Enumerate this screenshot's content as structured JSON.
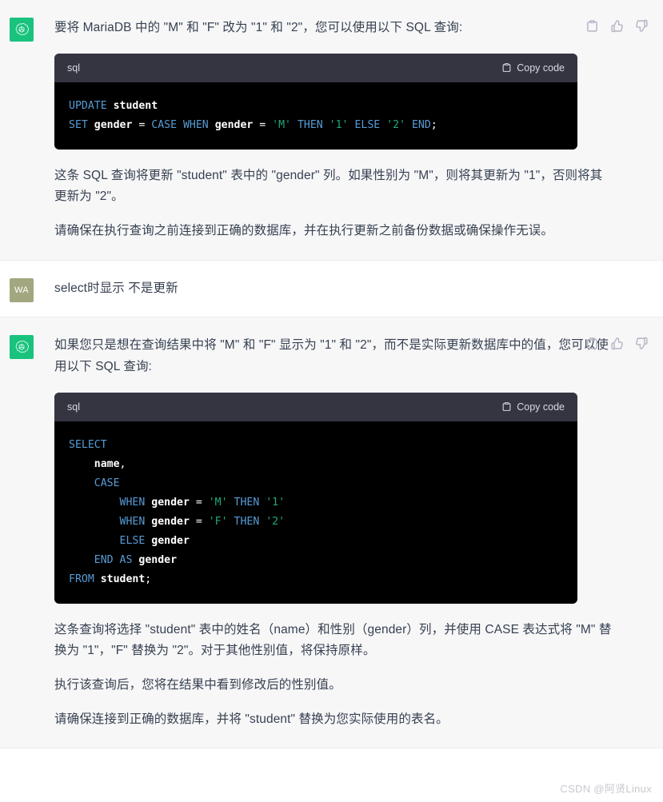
{
  "messages": [
    {
      "role": "assistant",
      "avatar_label": "",
      "paragraphs_before": [
        "要将 MariaDB 中的 \"M\" 和 \"F\" 改为 \"1\" 和 \"2\"，您可以使用以下 SQL 查询:"
      ],
      "code": {
        "lang": "sql",
        "copy_label": "Copy code",
        "lines": [
          [
            {
              "t": "UPDATE",
              "c": "kw"
            },
            {
              "t": " ",
              "c": "pn"
            },
            {
              "t": "student",
              "c": "id"
            }
          ],
          [
            {
              "t": "SET",
              "c": "kw"
            },
            {
              "t": " ",
              "c": "pn"
            },
            {
              "t": "gender",
              "c": "id"
            },
            {
              "t": " = ",
              "c": "pn"
            },
            {
              "t": "CASE",
              "c": "kw"
            },
            {
              "t": " ",
              "c": "pn"
            },
            {
              "t": "WHEN",
              "c": "kw"
            },
            {
              "t": " ",
              "c": "pn"
            },
            {
              "t": "gender",
              "c": "id"
            },
            {
              "t": " = ",
              "c": "pn"
            },
            {
              "t": "'M'",
              "c": "str"
            },
            {
              "t": " ",
              "c": "pn"
            },
            {
              "t": "THEN",
              "c": "kw"
            },
            {
              "t": " ",
              "c": "pn"
            },
            {
              "t": "'1'",
              "c": "str"
            },
            {
              "t": " ",
              "c": "pn"
            },
            {
              "t": "ELSE",
              "c": "kw"
            },
            {
              "t": " ",
              "c": "pn"
            },
            {
              "t": "'2'",
              "c": "str"
            },
            {
              "t": " ",
              "c": "pn"
            },
            {
              "t": "END",
              "c": "kw"
            },
            {
              "t": ";",
              "c": "pn"
            }
          ]
        ]
      },
      "paragraphs_after": [
        "这条 SQL 查询将更新 \"student\" 表中的 \"gender\" 列。如果性别为 \"M\"，则将其更新为 \"1\"，否则将其更新为 \"2\"。",
        "请确保在执行查询之前连接到正确的数据库，并在执行更新之前备份数据或确保操作无误。"
      ],
      "action_icons": [
        "copy-icon",
        "thumbs-up-icon",
        "thumbs-down-icon"
      ]
    },
    {
      "role": "user",
      "avatar_label": "WA",
      "text": "select时显示 不是更新"
    },
    {
      "role": "assistant",
      "avatar_label": "",
      "paragraphs_before": [
        "如果您只是想在查询结果中将 \"M\" 和 \"F\" 显示为 \"1\" 和 \"2\"，而不是实际更新数据库中的值，您可以使用以下 SQL 查询:"
      ],
      "code": {
        "lang": "sql",
        "copy_label": "Copy code",
        "lines": [
          [
            {
              "t": "SELECT",
              "c": "kw"
            }
          ],
          [
            {
              "t": "    ",
              "c": "pn"
            },
            {
              "t": "name",
              "c": "id"
            },
            {
              "t": ",",
              "c": "pn"
            }
          ],
          [
            {
              "t": "    ",
              "c": "pn"
            },
            {
              "t": "CASE",
              "c": "kw"
            }
          ],
          [
            {
              "t": "        ",
              "c": "pn"
            },
            {
              "t": "WHEN",
              "c": "kw"
            },
            {
              "t": " ",
              "c": "pn"
            },
            {
              "t": "gender",
              "c": "id"
            },
            {
              "t": " = ",
              "c": "pn"
            },
            {
              "t": "'M'",
              "c": "str"
            },
            {
              "t": " ",
              "c": "pn"
            },
            {
              "t": "THEN",
              "c": "kw"
            },
            {
              "t": " ",
              "c": "pn"
            },
            {
              "t": "'1'",
              "c": "str"
            }
          ],
          [
            {
              "t": "        ",
              "c": "pn"
            },
            {
              "t": "WHEN",
              "c": "kw"
            },
            {
              "t": " ",
              "c": "pn"
            },
            {
              "t": "gender",
              "c": "id"
            },
            {
              "t": " = ",
              "c": "pn"
            },
            {
              "t": "'F'",
              "c": "str"
            },
            {
              "t": " ",
              "c": "pn"
            },
            {
              "t": "THEN",
              "c": "kw"
            },
            {
              "t": " ",
              "c": "pn"
            },
            {
              "t": "'2'",
              "c": "str"
            }
          ],
          [
            {
              "t": "        ",
              "c": "pn"
            },
            {
              "t": "ELSE",
              "c": "kw"
            },
            {
              "t": " ",
              "c": "pn"
            },
            {
              "t": "gender",
              "c": "id"
            }
          ],
          [
            {
              "t": "    ",
              "c": "pn"
            },
            {
              "t": "END",
              "c": "kw"
            },
            {
              "t": " ",
              "c": "pn"
            },
            {
              "t": "AS",
              "c": "kw"
            },
            {
              "t": " ",
              "c": "pn"
            },
            {
              "t": "gender",
              "c": "id"
            }
          ],
          [
            {
              "t": "FROM",
              "c": "kw"
            },
            {
              "t": " ",
              "c": "pn"
            },
            {
              "t": "student",
              "c": "id"
            },
            {
              "t": ";",
              "c": "pn"
            }
          ]
        ]
      },
      "paragraphs_after": [
        "这条查询将选择 \"student\" 表中的姓名（name）和性别（gender）列，并使用 CASE 表达式将 \"M\" 替换为 \"1\"，\"F\" 替换为 \"2\"。对于其他性别值，将保持原样。",
        "执行该查询后，您将在结果中看到修改后的性别值。",
        "请确保连接到正确的数据库，并将 \"student\" 替换为您实际使用的表名。"
      ],
      "action_icons": [
        "copy-icon",
        "thumbs-up-icon",
        "thumbs-down-icon"
      ]
    }
  ],
  "watermark": "CSDN @阿贤Linux",
  "colors": {
    "assistant_bg": "#f7f7f8",
    "user_bg": "#ffffff",
    "gpt_avatar": "#19c37d",
    "user_avatar": "#a3a77f",
    "code_bg": "#000000",
    "code_header_bg": "#343541",
    "keyword": "#569cd6",
    "string": "#1fa87c",
    "text": "#374151"
  }
}
